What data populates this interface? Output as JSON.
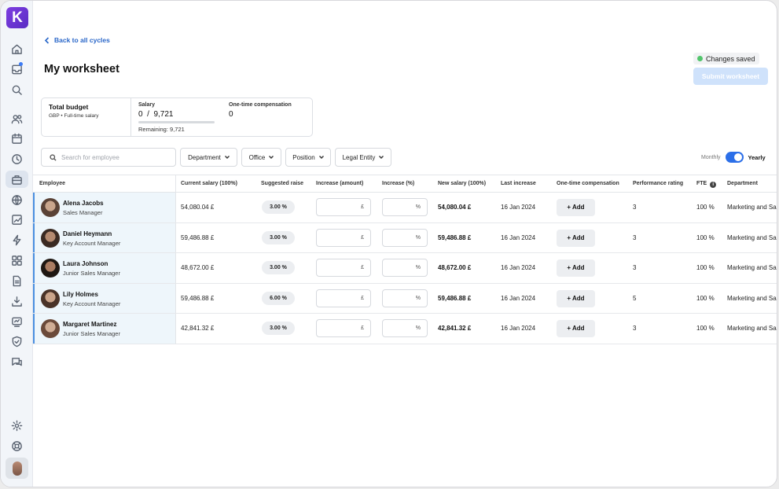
{
  "app": {
    "logo_letter": "K"
  },
  "sidebar": {
    "icons": [
      "home-icon",
      "inbox-icon",
      "search-icon",
      "people-icon",
      "calendar-icon",
      "clock-icon",
      "compensation-icon",
      "globe-icon",
      "chart-icon",
      "bolt-icon",
      "apps-icon",
      "document-icon",
      "download-icon",
      "review-icon",
      "shield-icon",
      "chat-icon",
      "settings-icon",
      "help-icon"
    ]
  },
  "header": {
    "back_label": "Back to all cycles",
    "title": "My worksheet",
    "saved_label": "Changes saved",
    "submit_label": "Submit worksheet"
  },
  "budget": {
    "total_label": "Total budget",
    "total_sub": "GBP • Full-time salary",
    "salary_label": "Salary",
    "salary_value": "0  /  9,721",
    "salary_used_fraction": 0,
    "remaining": "Remaining: 9,721",
    "onetime_label": "One-time compensation",
    "onetime_value": "0"
  },
  "filters": {
    "search_placeholder": "Search for employee",
    "department": "Department",
    "office": "Office",
    "position": "Position",
    "legal_entity": "Legal Entity",
    "monthly_label": "Monthly",
    "yearly_label": "Yearly",
    "yearly_selected": true
  },
  "table": {
    "columns": {
      "employee": "Employee",
      "current_salary": "Current salary (100%)",
      "suggested_raise": "Suggested raise",
      "increase_amount": "Increase (amount)",
      "increase_pct": "Increase (%)",
      "new_salary": "New salary (100%)",
      "last_increase": "Last increase",
      "one_time": "One-time compensation",
      "performance": "Performance rating",
      "fte": "FTE",
      "department": "Department"
    },
    "rows": [
      {
        "name": "Alena Jacobs",
        "role": "Sales Manager",
        "current": "54,080.04 £",
        "raise": "3.00 %",
        "amount_unit": "£",
        "pct_unit": "%",
        "new": "54,080.04 £",
        "last": "16 Jan 2024",
        "add": "+ Add",
        "perf": "3",
        "fte": "100 %",
        "dept": "Marketing and Sa"
      },
      {
        "name": "Daniel Heymann",
        "role": "Key Account Manager",
        "current": "59,486.88 £",
        "raise": "3.00 %",
        "amount_unit": "£",
        "pct_unit": "%",
        "new": "59,486.88 £",
        "last": "16 Jan 2024",
        "add": "+ Add",
        "perf": "3",
        "fte": "100 %",
        "dept": "Marketing and Sa"
      },
      {
        "name": "Laura Johnson",
        "role": "Junior Sales Manager",
        "current": "48,672.00 £",
        "raise": "3.00 %",
        "amount_unit": "£",
        "pct_unit": "%",
        "new": "48,672.00 £",
        "last": "16 Jan 2024",
        "add": "+ Add",
        "perf": "3",
        "fte": "100 %",
        "dept": "Marketing and Sa"
      },
      {
        "name": "Lily Holmes",
        "role": "Key Account Manager",
        "current": "59,486.88 £",
        "raise": "6.00 %",
        "amount_unit": "£",
        "pct_unit": "%",
        "new": "59,486.88 £",
        "last": "16 Jan 2024",
        "add": "+ Add",
        "perf": "5",
        "fte": "100 %",
        "dept": "Marketing and Sa"
      },
      {
        "name": "Margaret Martinez",
        "role": "Junior Sales Manager",
        "current": "42,841.32 £",
        "raise": "3.00 %",
        "amount_unit": "£",
        "pct_unit": "%",
        "new": "42,841.32 £",
        "last": "16 Jan 2024",
        "add": "+ Add",
        "perf": "3",
        "fte": "100 %",
        "dept": "Marketing and Sa"
      }
    ]
  },
  "colors": {
    "accent": "#2c6fe8",
    "brand": "#6a35d6",
    "selected_row": "#eef6fb",
    "submit_disabled": "#cfe2fb",
    "saved_dot": "#52c56c"
  }
}
